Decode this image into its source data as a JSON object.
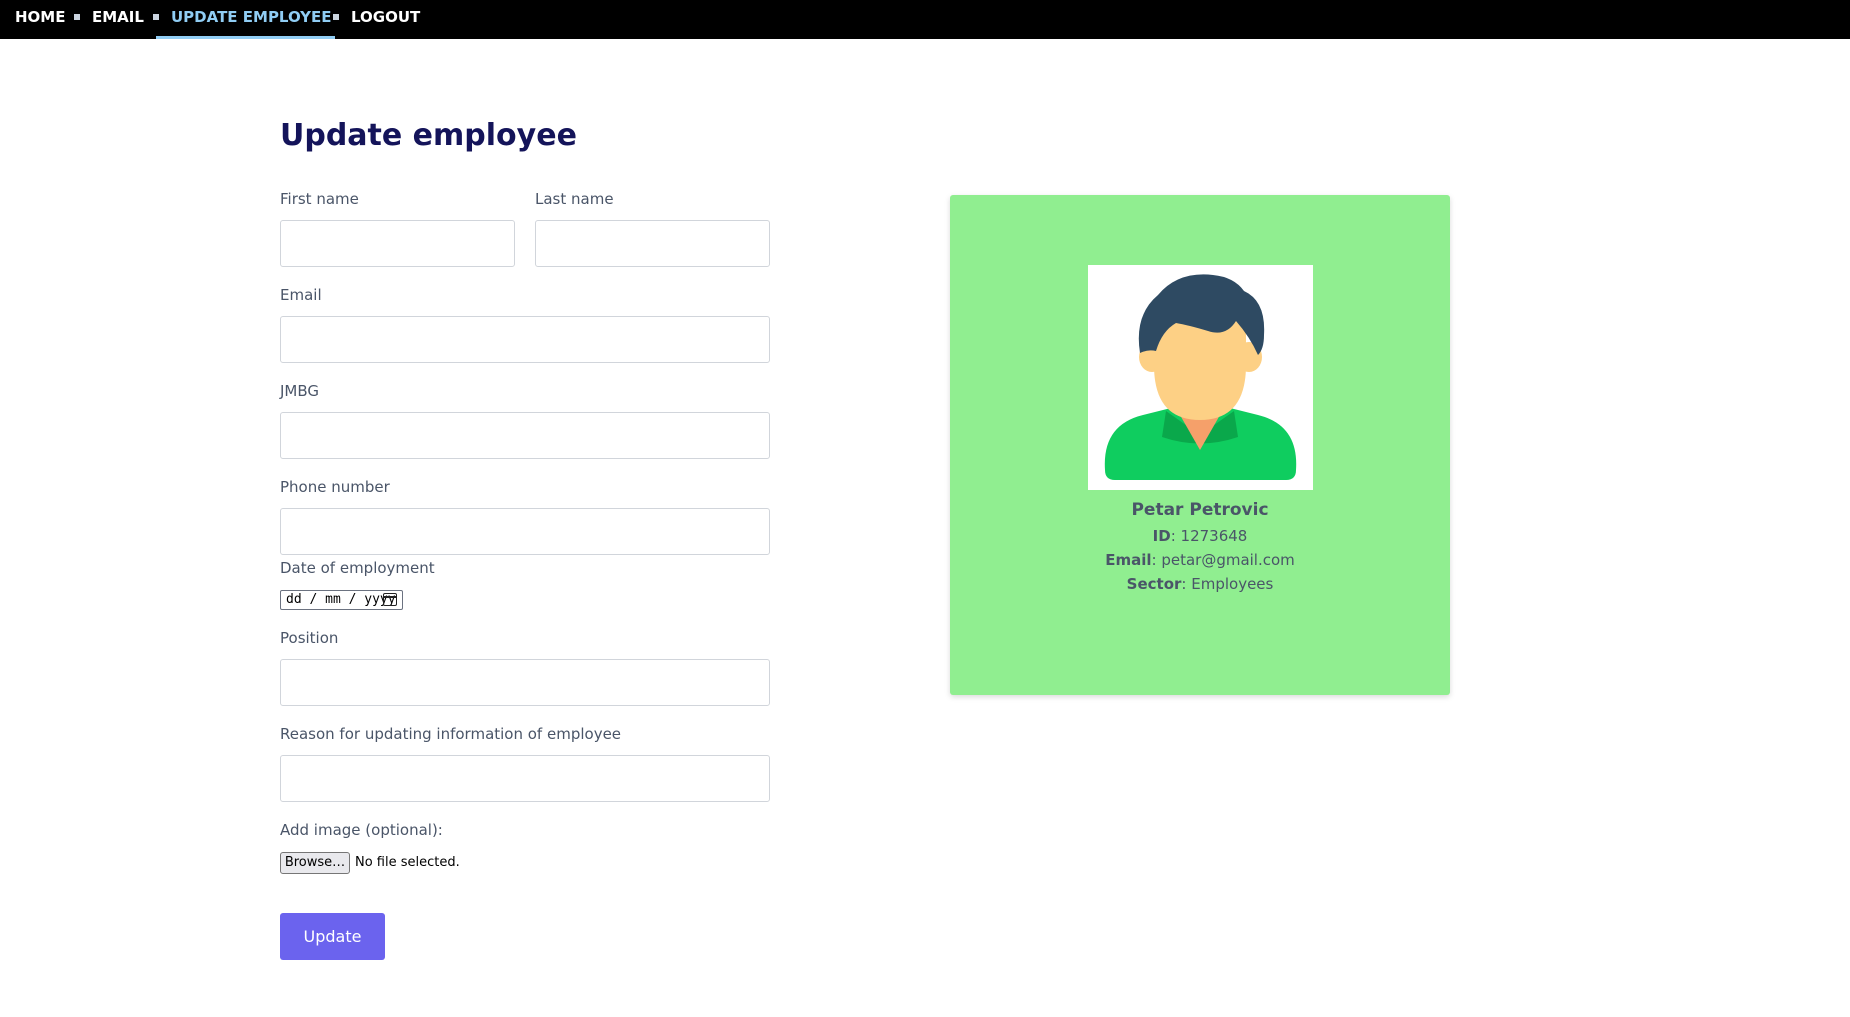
{
  "nav": {
    "items": [
      {
        "label": "HOME",
        "active": false
      },
      {
        "label": "EMAIL",
        "active": false
      },
      {
        "label": "UPDATE EMPLOYEE",
        "active": true
      },
      {
        "label": "LOGOUT",
        "active": false
      }
    ]
  },
  "form": {
    "title": "Update employee",
    "first_name_label": "First name",
    "first_name_value": "",
    "last_name_label": "Last name",
    "last_name_value": "",
    "email_label": "Email",
    "email_value": "",
    "jmbg_label": "JMBG",
    "jmbg_value": "",
    "phone_label": "Phone number",
    "phone_value": "",
    "date_label": "Date of employment",
    "date_placeholder": "dd / mm / yyyy",
    "position_label": "Position",
    "position_value": "",
    "reason_label": "Reason for updating information of employee",
    "reason_value": "",
    "image_label": "Add image (optional):",
    "browse_label": "Browse…",
    "file_status": "No file selected.",
    "submit_label": "Update"
  },
  "card": {
    "name": "Petar Petrovic",
    "id_label": "ID",
    "id_value": "1273648",
    "email_label": "Email",
    "email_value": "petar@gmail.com",
    "sector_label": "Sector",
    "sector_value": "Employees",
    "avatar_icon": "person-avatar-icon"
  },
  "colors": {
    "navbar_bg": "#000000",
    "nav_active": "#90cdf4",
    "title": "#14145a",
    "card_bg": "#90ee90",
    "button": "#6b63ee"
  }
}
